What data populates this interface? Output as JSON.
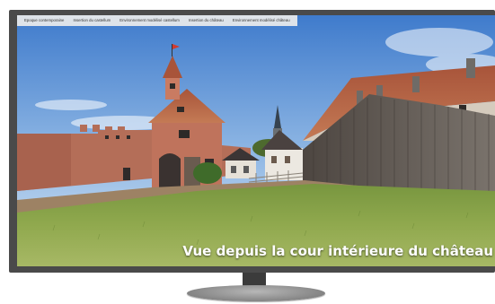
{
  "menu": {
    "items": [
      "Epoque contemporaine",
      "Insertion du castellum",
      "Environnement modélisé castellum",
      "Insertion du château",
      "Environnement modélisé château"
    ]
  },
  "caption": "Vue depuis la cour intérieure du château",
  "colors": {
    "monitor_frame": "#4a4a4a",
    "sky_top": "#4f86cf",
    "sky_bottom": "#c9dcef",
    "grass": "#6f8f3a",
    "brick": "#b66a55",
    "roof": "#b5623f",
    "wood": "#5d5650"
  }
}
